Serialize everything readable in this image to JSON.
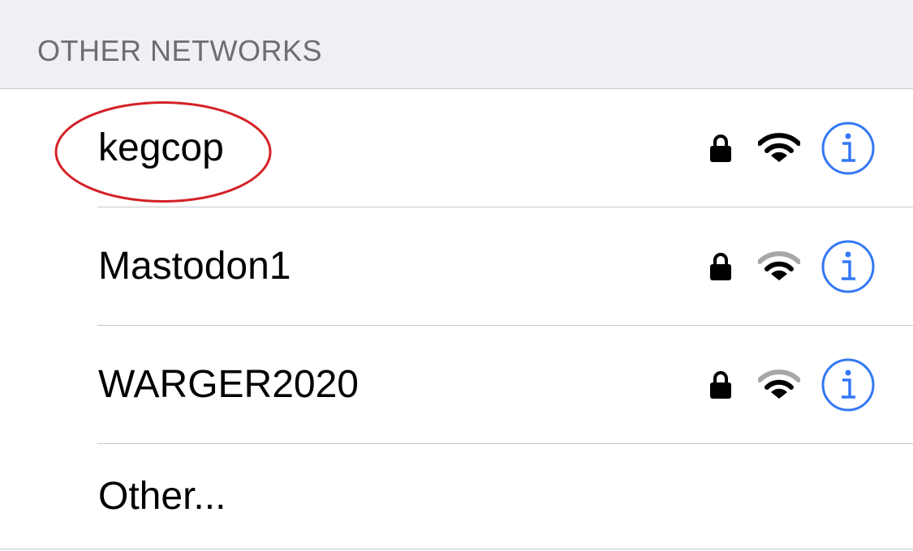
{
  "section": {
    "title": "OTHER NETWORKS"
  },
  "networks": [
    {
      "name": "kegcop",
      "secured": true,
      "signal_strength": "full",
      "icon_lock": "lock-icon",
      "icon_wifi": "wifi-icon",
      "icon_info": "info-icon"
    },
    {
      "name": "Mastodon1",
      "secured": true,
      "signal_strength": "partial",
      "icon_lock": "lock-icon",
      "icon_wifi": "wifi-icon",
      "icon_info": "info-icon"
    },
    {
      "name": "WARGER2020",
      "secured": true,
      "signal_strength": "partial",
      "icon_lock": "lock-icon",
      "icon_wifi": "wifi-icon",
      "icon_info": "info-icon"
    }
  ],
  "other": {
    "label": "Other..."
  },
  "colors": {
    "accent": "#3478f6",
    "annotation": "#d42127",
    "wifi_active": "#000000",
    "wifi_inactive": "#a7a7a7",
    "header_bg": "#efeff4",
    "header_text": "#6d6d72"
  }
}
